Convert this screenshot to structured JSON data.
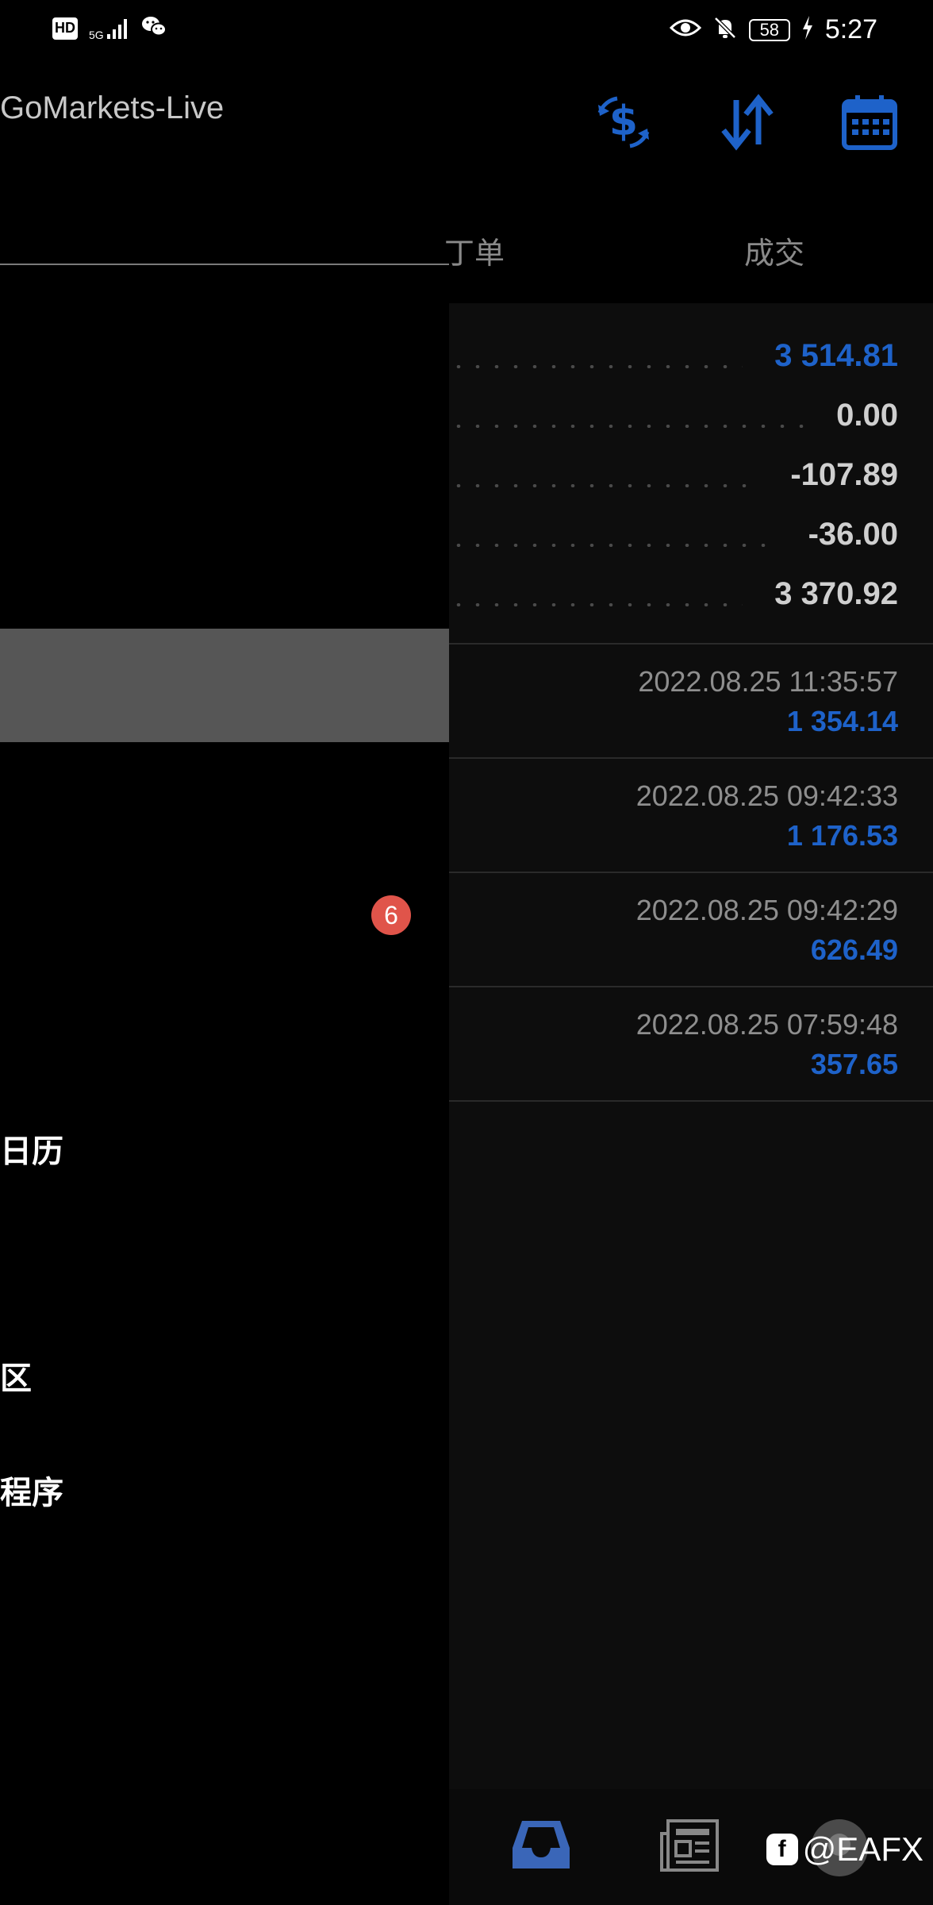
{
  "status_bar": {
    "hd": "HD",
    "network": "5G",
    "battery": "58",
    "time": "5:27"
  },
  "header": {
    "server": "GoMarkets-Live",
    "icons": [
      "currency-exchange-icon",
      "sort-icon",
      "calendar-icon"
    ]
  },
  "tabs": {
    "orders_partial": "丁单",
    "deals": "成交"
  },
  "summary": {
    "values": [
      "3 514.81",
      "0.00",
      "-107.89",
      "-36.00",
      "3 370.92"
    ]
  },
  "deals": [
    {
      "time": "2022.08.25 11:35:57",
      "amount": "1 354.14"
    },
    {
      "time": "2022.08.25 09:42:33",
      "amount": "1 176.53"
    },
    {
      "time": "2022.08.25 09:42:29",
      "amount": "626.49"
    },
    {
      "time": "2022.08.25 07:59:48",
      "amount": "357.65"
    }
  ],
  "drawer": {
    "badge": "6",
    "items": [
      "日历",
      "区",
      "程序"
    ]
  },
  "watermark": "@EAFX",
  "colors": {
    "accent_blue": "#1e62c9",
    "badge_red": "#e0544a",
    "highlight": "#565656"
  }
}
